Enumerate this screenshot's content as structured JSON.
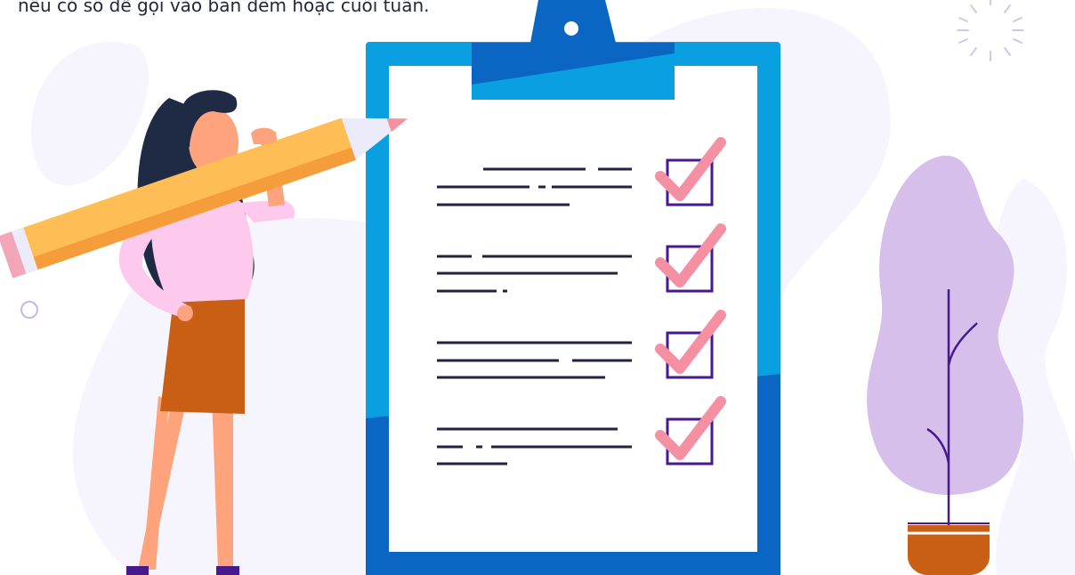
{
  "caption": "nếu có số để gọi vào ban đêm hoặc cuối tuần.",
  "checklist": {
    "items": [
      {
        "checked": true
      },
      {
        "checked": true
      },
      {
        "checked": true
      },
      {
        "checked": true
      }
    ]
  },
  "colors": {
    "clipboard_blue": "#0a9fe0",
    "clipboard_dark_blue": "#0b66c3",
    "paper": "#ffffff",
    "text_lines": "#1f2340",
    "check_mark": "#f58fa2",
    "check_box": "#46198f",
    "blob_background": "#f6f5fd",
    "plant_leaf": "#d6bfeb",
    "plant_stem": "#46198f",
    "pot": "#c95f15",
    "skirt": "#c95f15",
    "blouse": "#fdc9ec",
    "skin": "#fea37c",
    "hair": "#1f2a44",
    "pencil_body": "#ffbe55",
    "pencil_tip": "#ecebfb",
    "pencil_eraser": "#f58fa2",
    "shoes": "#46198f"
  }
}
